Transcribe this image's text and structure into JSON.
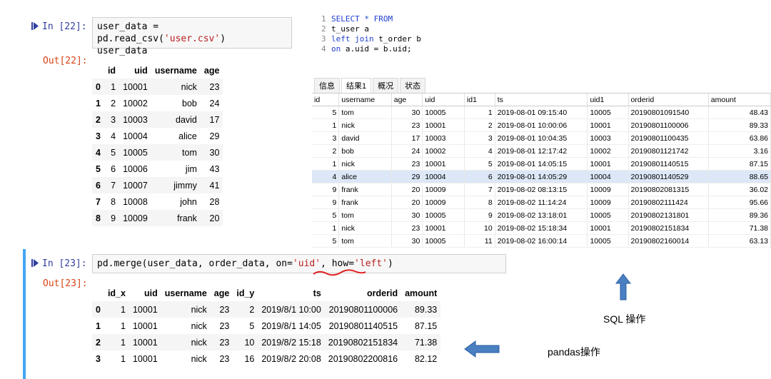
{
  "cell22": {
    "in_prompt": "In  [22]:",
    "code_line1_a": "user_data = pd.read_csv(",
    "code_line1_str": "'user.csv'",
    "code_line1_b": ")",
    "code_line2": "user_data",
    "out_prompt": "Out[22]:",
    "columns": [
      "id",
      "uid",
      "username",
      "age"
    ],
    "rows": [
      [
        "0",
        "1",
        "10001",
        "nick",
        "23"
      ],
      [
        "1",
        "2",
        "10002",
        "bob",
        "24"
      ],
      [
        "2",
        "3",
        "10003",
        "david",
        "17"
      ],
      [
        "3",
        "4",
        "10004",
        "alice",
        "29"
      ],
      [
        "4",
        "5",
        "10005",
        "tom",
        "30"
      ],
      [
        "5",
        "6",
        "10006",
        "jim",
        "43"
      ],
      [
        "6",
        "7",
        "10007",
        "jimmy",
        "41"
      ],
      [
        "7",
        "8",
        "10008",
        "john",
        "28"
      ],
      [
        "8",
        "9",
        "10009",
        "frank",
        "20"
      ]
    ]
  },
  "sql": {
    "lines": [
      {
        "n": "1",
        "kw": "SELECT * FROM",
        "rest": ""
      },
      {
        "n": "2",
        "kw": "",
        "rest": "t_user a"
      },
      {
        "n": "3",
        "kw": "left join",
        "rest": " t_order b"
      },
      {
        "n": "4",
        "kw": "on",
        "rest": " a.uid = b.uid;"
      }
    ],
    "tabs": [
      "信息",
      "结果1",
      "概况",
      "状态"
    ],
    "columns": [
      "id",
      "username",
      "age",
      "uid",
      "id1",
      "ts",
      "uid1",
      "orderid",
      "amount"
    ],
    "rows": [
      [
        "5",
        "tom",
        "30",
        "10005",
        "1",
        "2019-08-01 09:15:40",
        "10005",
        "20190801091540",
        "48.43"
      ],
      [
        "1",
        "nick",
        "23",
        "10001",
        "2",
        "2019-08-01 10:00:06",
        "10001",
        "20190801100006",
        "89.33"
      ],
      [
        "3",
        "david",
        "17",
        "10003",
        "3",
        "2019-08-01 10:04:35",
        "10003",
        "20190801100435",
        "63.86"
      ],
      [
        "2",
        "bob",
        "24",
        "10002",
        "4",
        "2019-08-01 12:17:42",
        "10002",
        "20190801121742",
        "3.16"
      ],
      [
        "1",
        "nick",
        "23",
        "10001",
        "5",
        "2019-08-01 14:05:15",
        "10001",
        "20190801140515",
        "87.15"
      ],
      [
        "4",
        "alice",
        "29",
        "10004",
        "6",
        "2019-08-01 14:05:29",
        "10004",
        "20190801140529",
        "88.65"
      ],
      [
        "9",
        "frank",
        "20",
        "10009",
        "7",
        "2019-08-02 08:13:15",
        "10009",
        "20190802081315",
        "36.02"
      ],
      [
        "9",
        "frank",
        "20",
        "10009",
        "8",
        "2019-08-02 11:14:24",
        "10009",
        "20190802111424",
        "95.66"
      ],
      [
        "5",
        "tom",
        "30",
        "10005",
        "9",
        "2019-08-02 13:18:01",
        "10005",
        "20190802131801",
        "89.36"
      ],
      [
        "1",
        "nick",
        "23",
        "10001",
        "10",
        "2019-08-02 15:18:34",
        "10001",
        "20190802151834",
        "71.38"
      ],
      [
        "5",
        "tom",
        "30",
        "10005",
        "11",
        "2019-08-02 16:00:14",
        "10005",
        "20190802160014",
        "63.13"
      ]
    ]
  },
  "cell23": {
    "in_prompt": "In  [23]:",
    "code_a": "pd.merge(user_data, order_data, on=",
    "code_str1": "'uid'",
    "code_b": ", how=",
    "code_str2": "'left'",
    "code_c": ")",
    "out_prompt": "Out[23]:",
    "columns": [
      "id_x",
      "uid",
      "username",
      "age",
      "id_y",
      "ts",
      "orderid",
      "amount"
    ],
    "rows": [
      [
        "0",
        "1",
        "10001",
        "nick",
        "23",
        "2",
        "2019/8/1 10:00",
        "20190801100006",
        "89.33"
      ],
      [
        "1",
        "1",
        "10001",
        "nick",
        "23",
        "5",
        "2019/8/1 14:05",
        "20190801140515",
        "87.15"
      ],
      [
        "2",
        "1",
        "10001",
        "nick",
        "23",
        "10",
        "2019/8/2 15:18",
        "20190802151834",
        "71.38"
      ],
      [
        "3",
        "1",
        "10001",
        "nick",
        "23",
        "16",
        "2019/8/2 20:08",
        "20190802200816",
        "82.12"
      ]
    ]
  },
  "annotations": {
    "sql_label": "SQL 操作",
    "pandas_label": "pandas操作"
  },
  "colors": {
    "arrow": "#4a7fc1",
    "underline": "#e02020",
    "prompt_in": "#303f9f",
    "prompt_out": "#d84315"
  }
}
